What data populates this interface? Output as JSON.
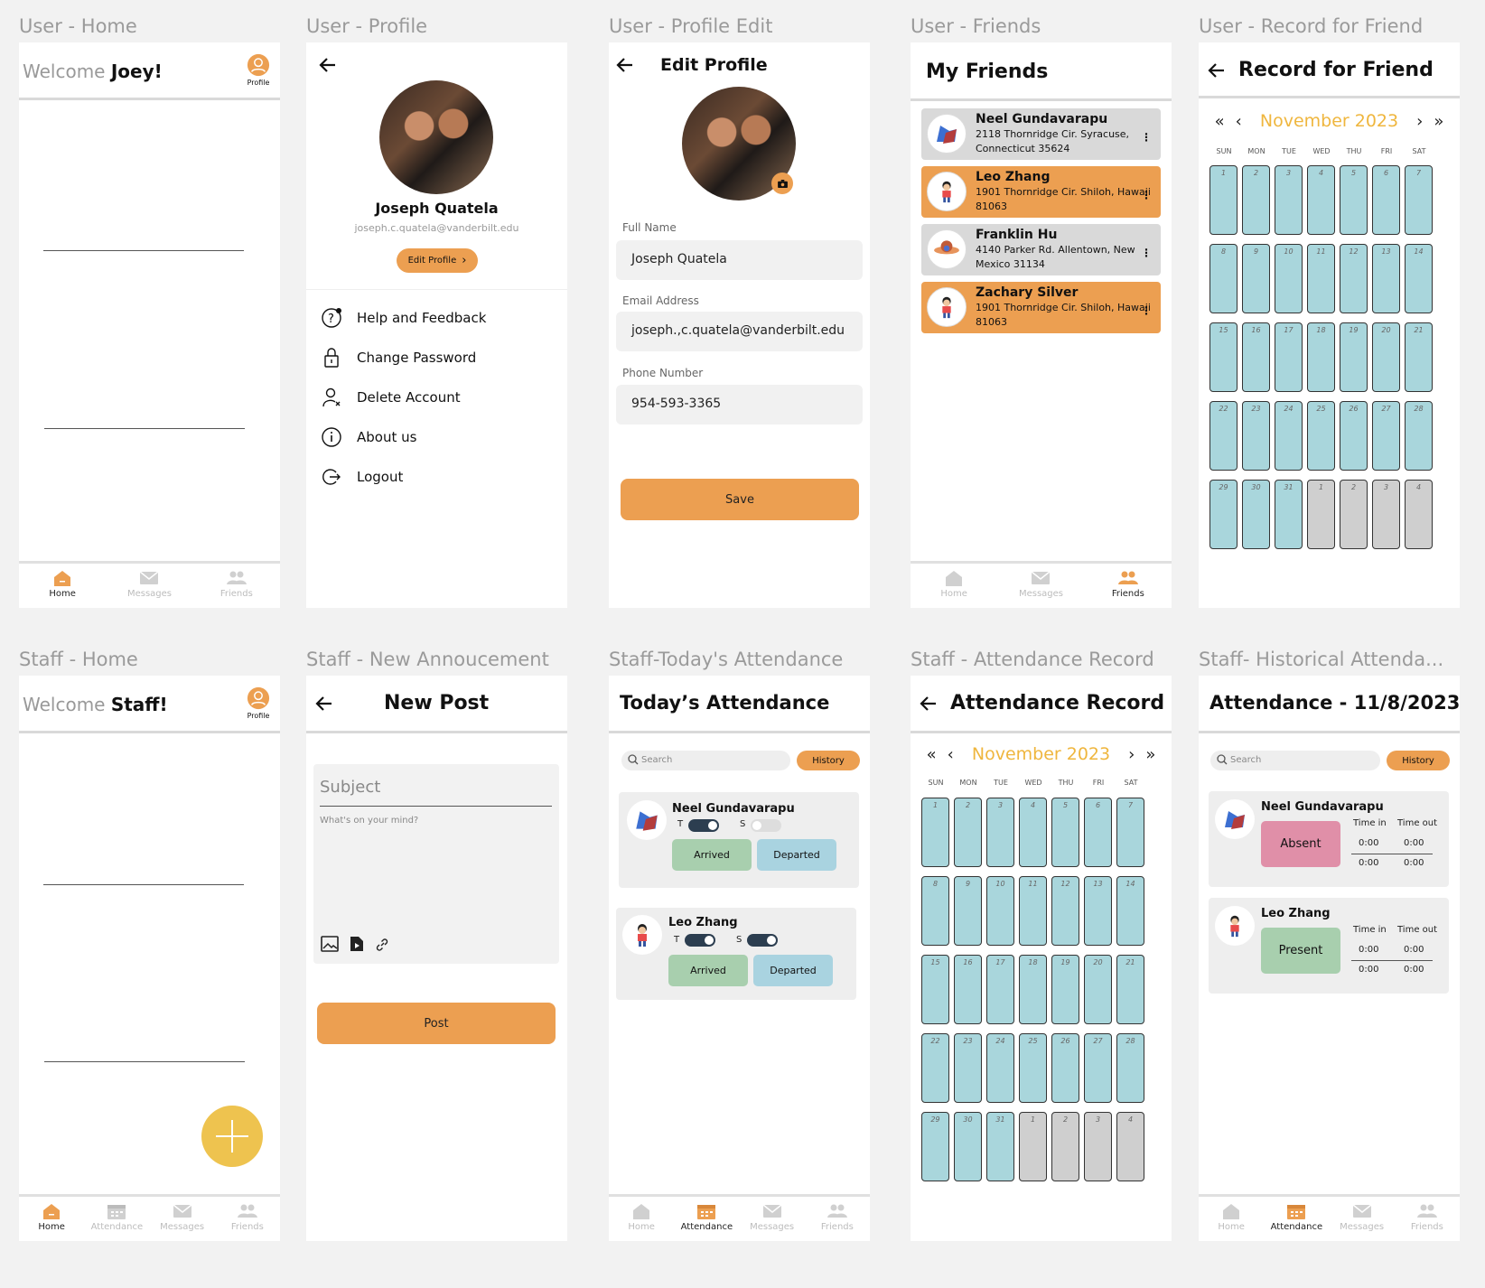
{
  "labels": {
    "u_home": "User - Home",
    "u_profile": "User - Profile",
    "u_profile_edit": "User - Profile Edit",
    "u_friends": "User - Friends",
    "u_record": "User - Record for Friend",
    "s_home": "Staff - Home",
    "s_new": "Staff - New Annoucement",
    "s_today": "Staff-Today's Attendance",
    "s_record": "Staff - Attendance Record",
    "s_hist": "Staff- Historical Attenda..."
  },
  "nav": {
    "home": "Home",
    "attendance": "Attendance",
    "messages": "Messages",
    "friends": "Friends"
  },
  "user_home": {
    "welcome": "Welcome",
    "name": "Joey!",
    "profile": "Profile"
  },
  "profile": {
    "name": "Joseph Quatela",
    "email": "joseph.c.quatela@vanderbilt.edu",
    "edit_btn": "Edit Profile",
    "menu": [
      "Help and Feedback",
      "Change Password",
      "Delete Account",
      "About us",
      "Logout"
    ]
  },
  "edit": {
    "title": "Edit Profile",
    "full_name_label": "Full Name",
    "full_name": "Joseph Quatela",
    "email_label": "Email Address",
    "email": "joseph.,c.quatela@vanderbilt.edu",
    "phone_label": "Phone Number",
    "phone": "954-593-3365",
    "save": "Save"
  },
  "friends": {
    "title": "My Friends",
    "list": [
      {
        "name": "Neel Gundavarapu",
        "addr1": "2118 Thornridge Cir. Syracuse,",
        "addr2": "Connecticut 35624",
        "color": "#d9d9d9"
      },
      {
        "name": "Leo Zhang",
        "addr1": "1901 Thornridge Cir. Shiloh, Hawaii",
        "addr2": "81063",
        "color": "#ec9f51"
      },
      {
        "name": "Franklin Hu",
        "addr1": "4140 Parker Rd. Allentown, New",
        "addr2": "Mexico 31134",
        "color": "#d9d9d9"
      },
      {
        "name": "Zachary Silver",
        "addr1": "1901 Thornridge Cir. Shiloh, Hawaii",
        "addr2": "81063",
        "color": "#ec9f51"
      }
    ]
  },
  "record": {
    "title": "Record for Friend"
  },
  "calendar": {
    "month": "November 2023",
    "dow": [
      "SUN",
      "MON",
      "TUE",
      "WED",
      "THU",
      "FRI",
      "SAT"
    ],
    "days": [
      "1",
      "2",
      "3",
      "4",
      "5",
      "6",
      "7",
      "8",
      "9",
      "10",
      "11",
      "12",
      "13",
      "14",
      "15",
      "16",
      "17",
      "18",
      "19",
      "20",
      "21",
      "22",
      "23",
      "24",
      "25",
      "26",
      "27",
      "28",
      "29",
      "30",
      "31",
      "1",
      "2",
      "3",
      "4"
    ]
  },
  "staff_home": {
    "welcome": "Welcome",
    "name": "Staff!",
    "profile": "Profile"
  },
  "new_post": {
    "title": "New Post",
    "subject": "Subject",
    "body": "What's on your mind?",
    "post": "Post"
  },
  "today": {
    "title": "Today’s Attendance",
    "search": "Search",
    "history": "History",
    "t": "T",
    "s": "S",
    "arrived": "Arrived",
    "departed": "Departed",
    "people": [
      "Neel Gundavarapu",
      "Leo Zhang"
    ]
  },
  "att_record": {
    "title": "Attendance Record"
  },
  "historical": {
    "title": "Attendance - 11/8/2023",
    "search": "Search",
    "history": "History",
    "time_in": "Time in",
    "time_out": "Time out",
    "t": "0:00",
    "people": [
      {
        "name": "Neel Gundavarapu",
        "status": "Absent",
        "color": "#e08fa8"
      },
      {
        "name": "Leo Zhang",
        "status": "Present",
        "color": "#a8cfae"
      }
    ]
  },
  "colors": {
    "accent": "#ec9f51",
    "month": "#efb63e",
    "cell": "#a9d6dc",
    "gray": "#cfcfcf"
  }
}
